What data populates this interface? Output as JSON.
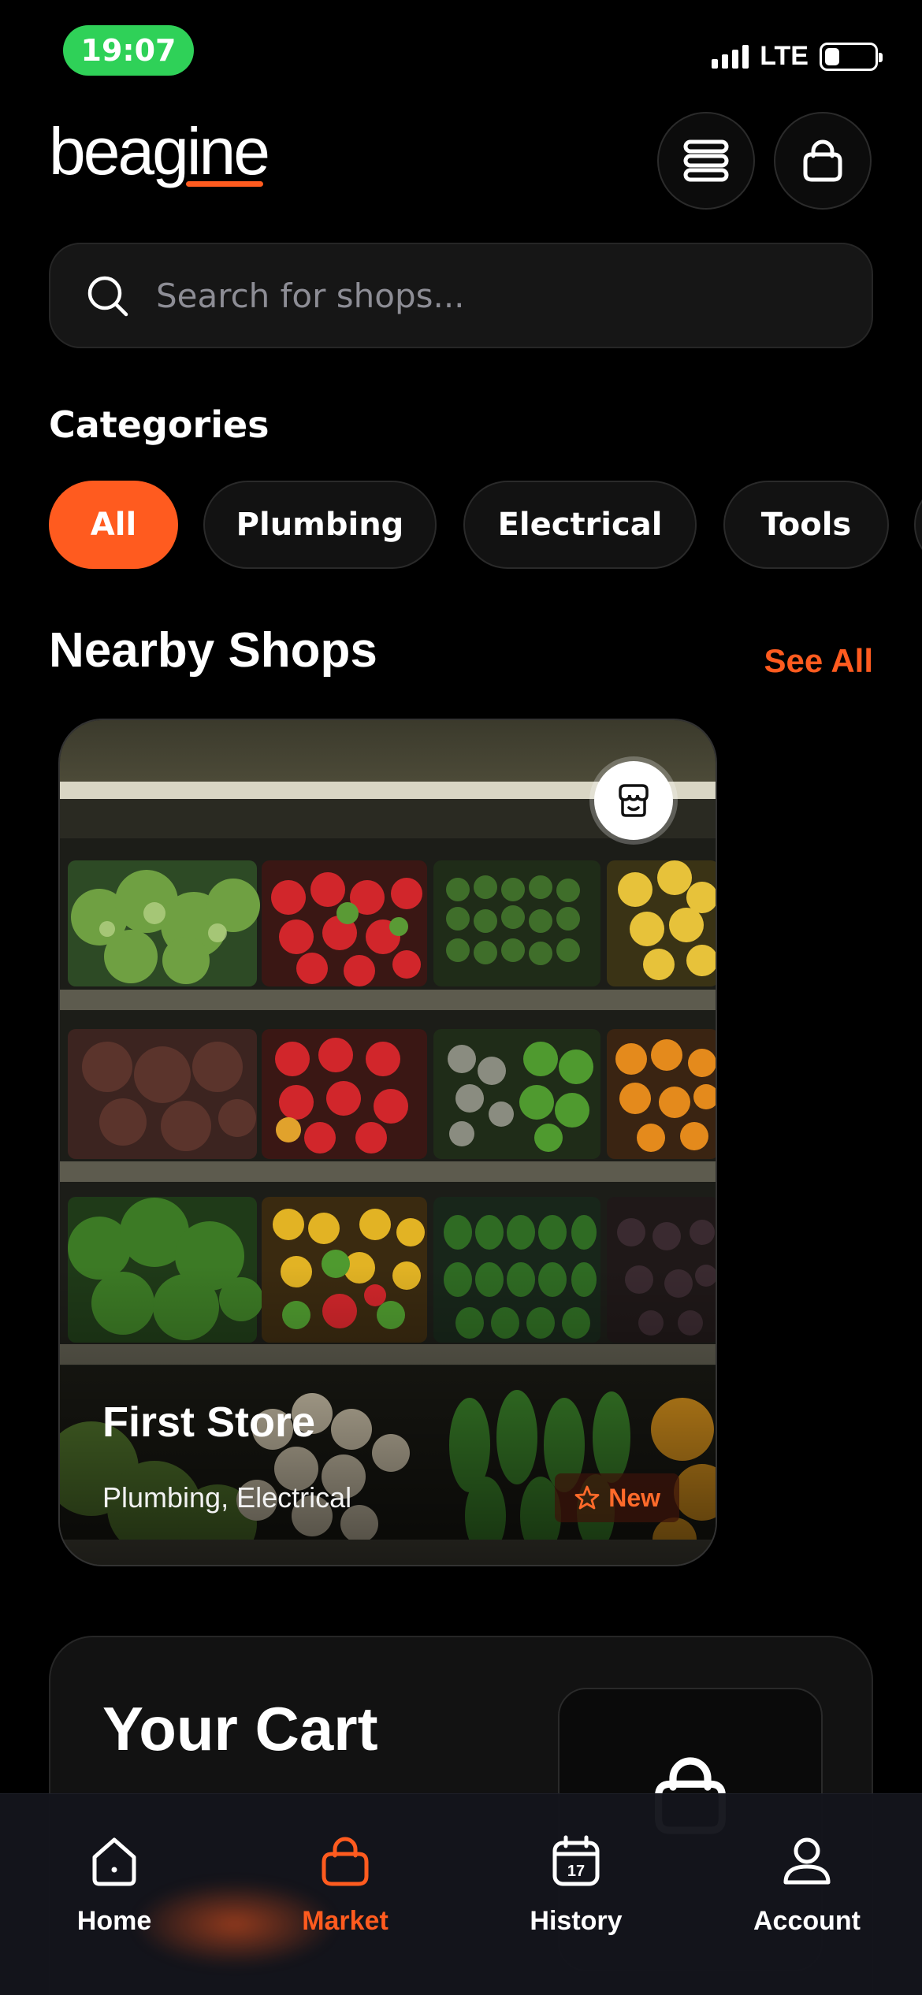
{
  "status_bar": {
    "time": "19:07",
    "network": "LTE",
    "icons": [
      "signal-icon",
      "battery-icon"
    ]
  },
  "header": {
    "logo_text": "beagine",
    "brand_color": "#ff5b1f",
    "menu_icon": "menu-icon",
    "bag_icon": "shopping-bag-icon"
  },
  "search": {
    "placeholder": "Search for shops...",
    "value": ""
  },
  "categories": {
    "title": "Categories",
    "items": [
      {
        "label": "All",
        "active": true
      },
      {
        "label": "Plumbing",
        "active": false
      },
      {
        "label": "Electrical",
        "active": false
      },
      {
        "label": "Tools",
        "active": false
      }
    ]
  },
  "nearby": {
    "title": "Nearby Shops",
    "see_all": "See All",
    "shops": [
      {
        "name": "First Store",
        "tags": "Plumbing, Electrical",
        "badge": "New",
        "icon": "store-icon"
      }
    ]
  },
  "cart": {
    "title": "Your Cart"
  },
  "bottom_nav": {
    "items": [
      {
        "label": "Home",
        "icon": "home-icon",
        "active": false
      },
      {
        "label": "Market",
        "icon": "shopping-bag-icon",
        "active": true
      },
      {
        "label": "History",
        "icon": "calendar-icon",
        "active": false
      },
      {
        "label": "Account",
        "icon": "user-icon",
        "active": false
      }
    ],
    "history_icon_day": "17"
  },
  "colors": {
    "accent": "#ff5b1f",
    "time_pill": "#2fd158",
    "background": "#000000"
  }
}
